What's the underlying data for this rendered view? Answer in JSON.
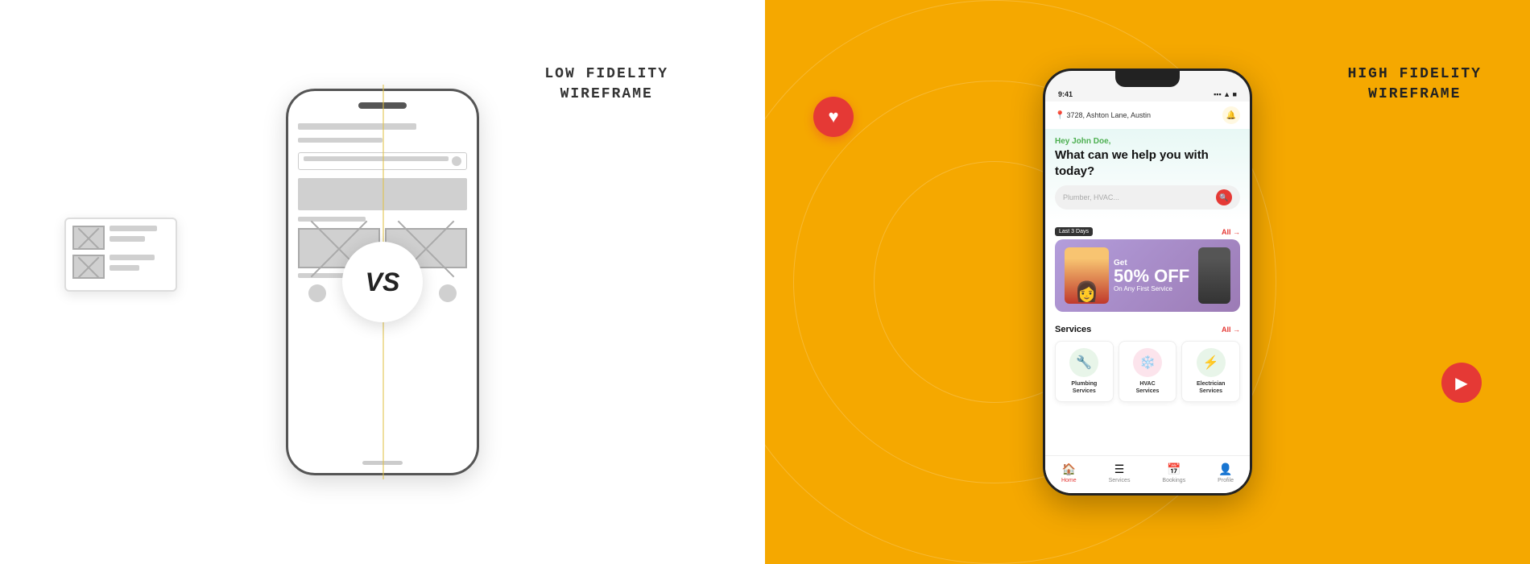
{
  "left": {
    "label_line1": "LOW FIDELITY",
    "label_line2": "WIREFRAME"
  },
  "right": {
    "label_line1": "HIGH FIDELITY",
    "label_line2": "WIREFRAME",
    "heart_icon": "♥",
    "play_icon": "▶"
  },
  "vs": {
    "text": "VS"
  },
  "app": {
    "status_time": "9:41",
    "location": "3728, Ashton Lane, Austin",
    "greeting": "Hey John Doe,",
    "hero_title": "What can we help you with today?",
    "search_placeholder": "Plumber, HVAC...",
    "last3days": "Last 3 Days",
    "all_label": "All →",
    "promo_get": "Get",
    "promo_percent": "50% OFF",
    "promo_sub": "On Any First Service",
    "services_title": "Services",
    "services_all": "All →",
    "services": [
      {
        "name": "Plumbing\nServices",
        "icon": "🔧",
        "bg": "#e8f5e9"
      },
      {
        "name": "HVAC\nServices",
        "icon": "❄️",
        "bg": "#fce4ec"
      },
      {
        "name": "Electrician\nServices",
        "icon": "⚡",
        "bg": "#e8f5e9"
      }
    ],
    "nav": [
      {
        "label": "Home",
        "icon": "🏠",
        "active": true
      },
      {
        "label": "Services",
        "icon": "☰",
        "active": false
      },
      {
        "label": "Bookings",
        "icon": "📅",
        "active": false
      },
      {
        "label": "Profile",
        "icon": "👤",
        "active": false
      }
    ]
  }
}
